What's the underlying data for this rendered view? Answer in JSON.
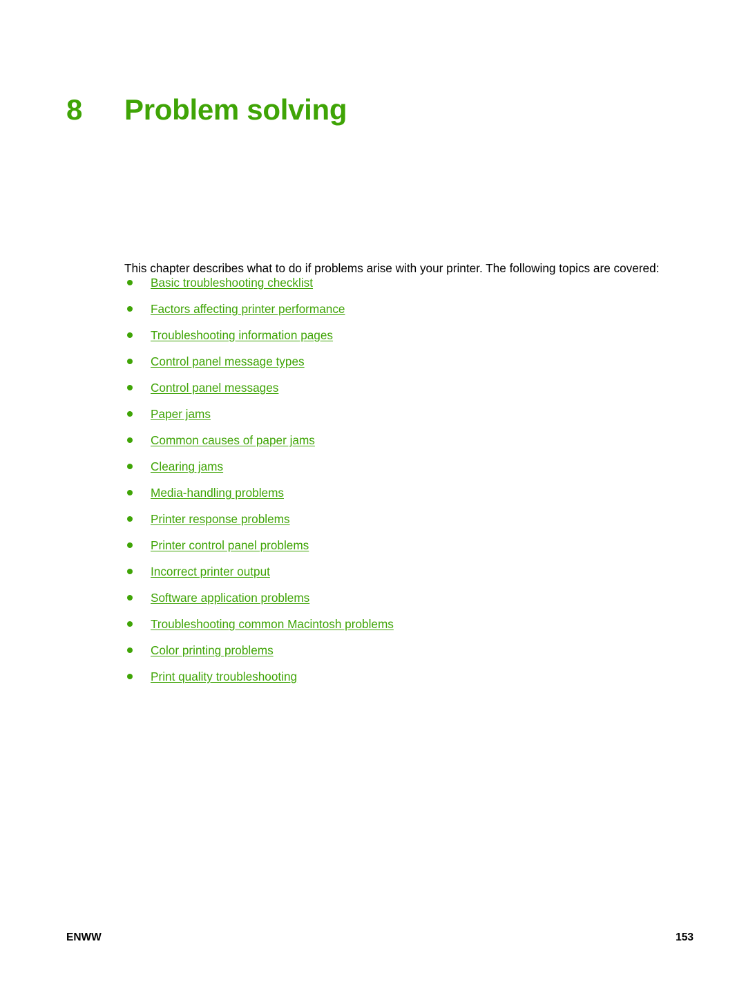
{
  "page": {
    "chapter_number": "8",
    "chapter_title": "Problem solving",
    "accent_color": "#3fa406",
    "text_color": "#000000",
    "background_color": "#ffffff"
  },
  "intro": {
    "text": "This chapter describes what to do if problems arise with your printer. The following topics are covered:"
  },
  "topics": [
    {
      "label": "Basic troubleshooting checklist"
    },
    {
      "label": "Factors affecting printer performance"
    },
    {
      "label": "Troubleshooting information pages"
    },
    {
      "label": "Control panel message types"
    },
    {
      "label": "Control panel messages"
    },
    {
      "label": "Paper jams"
    },
    {
      "label": "Common causes of paper jams"
    },
    {
      "label": "Clearing jams"
    },
    {
      "label": "Media-handling problems"
    },
    {
      "label": "Printer response problems"
    },
    {
      "label": "Printer control panel problems"
    },
    {
      "label": "Incorrect printer output"
    },
    {
      "label": "Software application problems"
    },
    {
      "label": "Troubleshooting common Macintosh problems"
    },
    {
      "label": "Color printing problems"
    },
    {
      "label": "Print quality troubleshooting"
    }
  ],
  "footer": {
    "left_label": "ENWW",
    "page_number": "153"
  }
}
